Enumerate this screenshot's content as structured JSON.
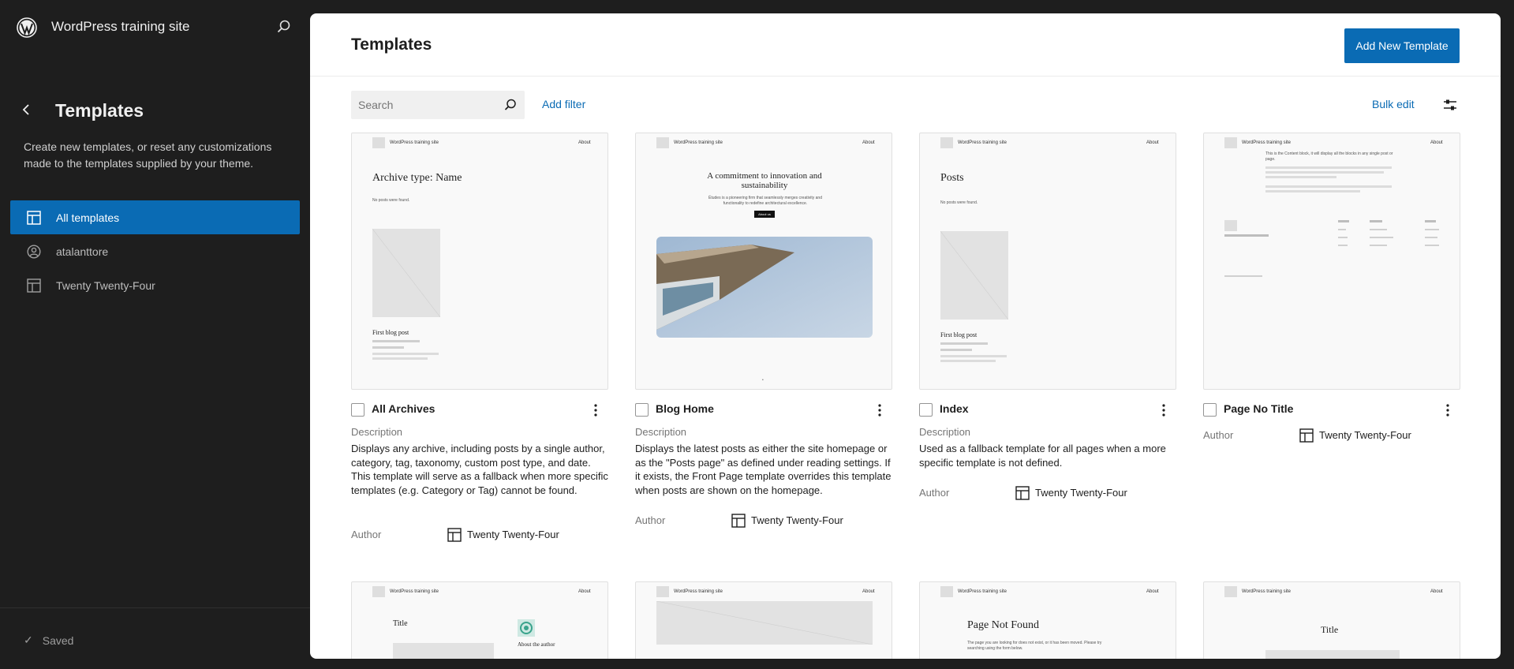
{
  "site": {
    "title": "WordPress training site"
  },
  "sidebar": {
    "title": "Templates",
    "description": "Create new templates, or reset any customizations made to the templates supplied by your theme.",
    "items": [
      {
        "label": "All templates",
        "icon": "layout-icon"
      },
      {
        "label": "atalanttore",
        "icon": "user-circle-icon"
      },
      {
        "label": "Twenty Twenty-Four",
        "icon": "layout-icon"
      }
    ],
    "status": "Saved"
  },
  "main": {
    "title": "Templates",
    "add_button": "Add New Template",
    "search_placeholder": "Search",
    "add_filter": "Add filter",
    "bulk_edit": "Bulk edit"
  },
  "labels": {
    "description": "Description",
    "author": "Author"
  },
  "templates": [
    {
      "title": "All Archives",
      "description": "Displays any archive, including posts by a single author, category, tag, taxonomy, custom post type, and date. This template will serve as a fallback when more specific templates (e.g. Category or Tag) cannot be found.",
      "author": "Twenty Twenty-Four",
      "preview": {
        "site": "WordPress training site",
        "about": "About",
        "heading": "Archive type: Name",
        "note": "No posts were found.",
        "post_title": "First blog post"
      }
    },
    {
      "title": "Blog Home",
      "description": "Displays the latest posts as either the site homepage or as the \"Posts page\" as defined under reading settings. If it exists, the Front Page template overrides this template when posts are shown on the homepage.",
      "author": "Twenty Twenty-Four",
      "preview": {
        "site": "WordPress training site",
        "about": "About",
        "heading": "A commitment to innovation and sustainability",
        "note": "Études is a pioneering firm that seamlessly merges creativity and functionality to redefine architectural excellence.",
        "button": "About us"
      }
    },
    {
      "title": "Index",
      "description": "Used as a fallback template for all pages when a more specific template is not defined.",
      "author": "Twenty Twenty-Four",
      "preview": {
        "site": "WordPress training site",
        "about": "About",
        "heading": "Posts",
        "note": "No posts were found.",
        "post_title": "First blog post"
      }
    },
    {
      "title": "Page No Title",
      "description": "",
      "author": "Twenty Twenty-Four",
      "preview": {
        "site": "WordPress training site",
        "about": "About",
        "heading": "",
        "note": "This is the Content block, it will display all the blocks in any single post or page."
      }
    }
  ],
  "row2": [
    {
      "site": "WordPress training site",
      "about": "About",
      "heading": "Title",
      "side": "About the author"
    },
    {
      "site": "WordPress training site",
      "about": "About",
      "heading": ""
    },
    {
      "site": "WordPress training site",
      "about": "About",
      "heading": "Page Not Found",
      "note": "The page you are looking for does not exist, or it has been moved. Please try searching using the form below."
    },
    {
      "site": "WordPress training site",
      "about": "About",
      "heading": "Title"
    }
  ]
}
